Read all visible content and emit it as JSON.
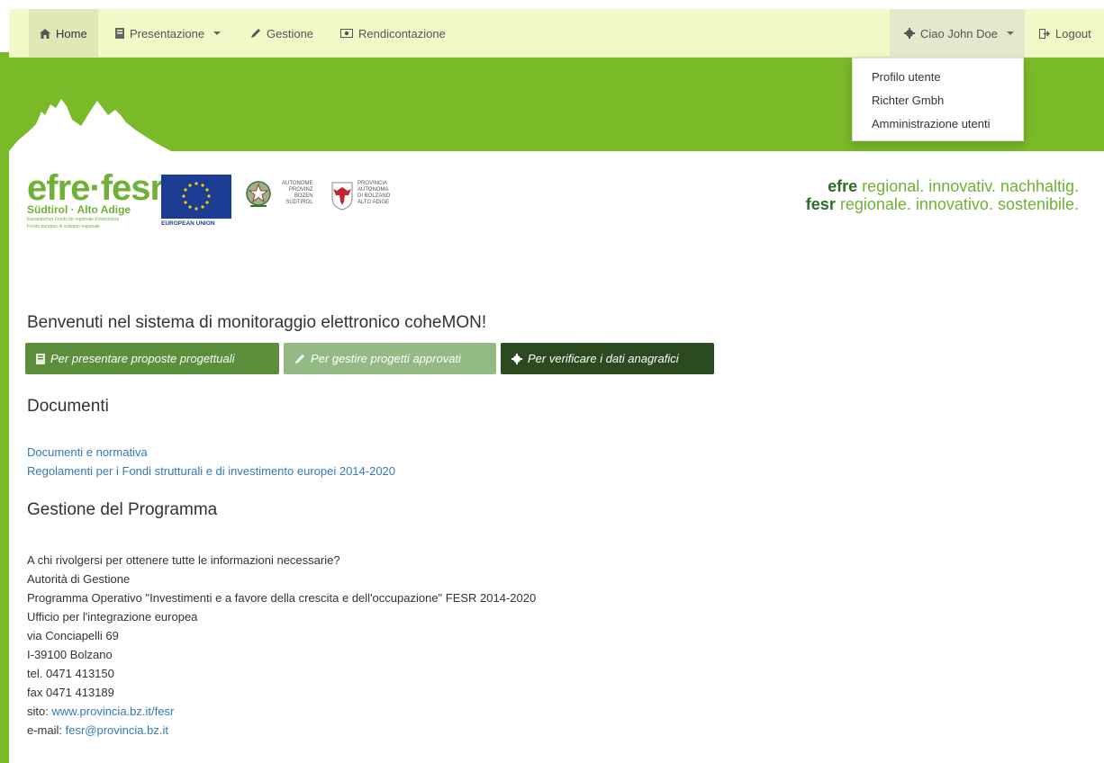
{
  "nav": {
    "home": "Home",
    "presentazione": "Presentazione",
    "gestione": "Gestione",
    "rendicontazione": "Rendicontazione",
    "user": "Ciao John Doe",
    "logout": "Logout"
  },
  "user_menu": {
    "items": [
      "Profilo utente",
      "Richter Gmbh",
      "Amministrazione utenti"
    ]
  },
  "logos": {
    "efre_word": "efre·fesr",
    "efre_sub": "Südtirol · Alto Adige",
    "efre_mini1": "Europäischer Fonds für regionale Entwicklung",
    "efre_mini2": "Fondo europeo di sviluppo regionale",
    "eu": "EUROPEAN UNION",
    "prov_de": [
      "AUTONOME",
      "PROVINZ",
      "BOZEN",
      "SÜDTIROL"
    ],
    "prov_it": [
      "PROVINCIA",
      "AUTONOMA",
      "DI BOLZANO",
      "ALTO ADIGE"
    ]
  },
  "slogan": {
    "line1_bold": "efre",
    "line1_rest": " regional. innovativ. nachhaltig.",
    "line2_bold": "fesr",
    "line2_rest": " regionale. innovativo. sostenibile."
  },
  "welcome": "Benvenuti nel sistema di monitoraggio elettronico coheMON!",
  "buttons": {
    "proposte": "Per presentare proposte progettuali",
    "gestire": "Per gestire progetti approvati",
    "verificare": "Per verificare i dati anagrafici"
  },
  "documenti": {
    "title": "Documenti",
    "link1": "Documenti e normativa",
    "link2": "Regolamenti per i Fondi strutturali e di investimento europei 2014-2020"
  },
  "gestione_programma": {
    "title": "Gestione del Programma",
    "lines": [
      "A chi rivolgersi per ottenere tutte le informazioni necessarie?",
      "Autorità di Gestione",
      "Programma Operativo \"Investimenti e a favore della crescita e dell'occupazione\" FESR 2014-2020",
      "Ufficio per l'integrazione europea",
      "via Conciapelli 69",
      "I-39100 Bolzano",
      "tel. 0471 413150",
      "fax 0471 413189"
    ],
    "sito_label": "sito: ",
    "sito_link": "www.provincia.bz.it/fesr",
    "email_label": "e-mail: ",
    "email_link": "fesr@provincia.bz.it"
  },
  "colors": {
    "brand_green": "#7ab928",
    "navbar_bg": "#f0fac8",
    "link": "#337ab7"
  }
}
